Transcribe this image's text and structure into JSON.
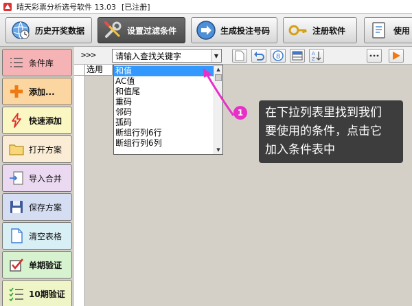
{
  "window": {
    "title": "晴天彩票分析选号软件 13.03",
    "registration_status": "[已注册]"
  },
  "toolbar": {
    "buttons": [
      {
        "label": "历史开奖数据",
        "icon": "globe-clock-icon"
      },
      {
        "label": "设置过滤条件",
        "icon": "tools-icon",
        "active": true
      },
      {
        "label": "生成投注号码",
        "icon": "arrow-right-circle-icon"
      },
      {
        "label": "注册软件",
        "icon": "key-icon"
      },
      {
        "label": "使用",
        "icon": "manual-icon"
      }
    ]
  },
  "sidebar": {
    "items": [
      {
        "label": "条件库",
        "icon": "list-icon",
        "color": "#f6b3b6"
      },
      {
        "label": "添加...",
        "icon": "plus-icon",
        "color": "#fcd6a0"
      },
      {
        "label": "快速添加",
        "icon": "lightning-icon",
        "color": "#fbf7c3"
      },
      {
        "label": "打开方案",
        "icon": "folder-icon",
        "color": "#fbecd5"
      },
      {
        "label": "导入合并",
        "icon": "import-icon",
        "color": "#ead9f1"
      },
      {
        "label": "保存方案",
        "icon": "save-icon",
        "color": "#d5ddf3"
      },
      {
        "label": "清空表格",
        "icon": "blank-page-icon",
        "color": "#d8f0f5"
      },
      {
        "label": "单期验证",
        "icon": "check-box-icon",
        "color": "#d6f2cf"
      },
      {
        "label": "10期验证",
        "icon": "checklist-icon",
        "color": "#f0f5c8"
      }
    ]
  },
  "filter_bar": {
    "expander": ">>>",
    "search_combo_text": "请输入查找关键字",
    "icon_buttons": [
      "new-page-icon",
      "undo-icon",
      "eight-circle-icon",
      "grid-icon",
      "sort-az-icon",
      "more-icon",
      "play-icon"
    ]
  },
  "grid": {
    "column_header": "选用"
  },
  "dropdown": {
    "items": [
      "和值",
      "AC值",
      "和值尾",
      "重码",
      "邻码",
      "孤码",
      "断组行列6行",
      "断组行列6列"
    ],
    "selected_index": 0
  },
  "callout": {
    "step": "1",
    "lines": [
      "在下拉列表里找到我们",
      "要使用的条件，点击它",
      "加入条件表中"
    ]
  }
}
